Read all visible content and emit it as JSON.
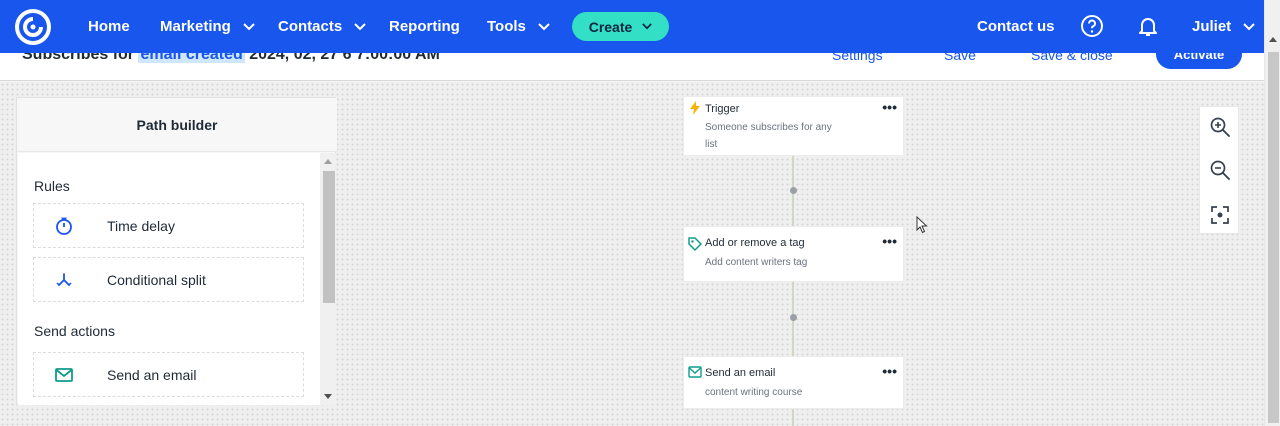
{
  "nav": {
    "home": "Home",
    "marketing": "Marketing",
    "contacts": "Contacts",
    "reporting": "Reporting",
    "tools": "Tools",
    "create": "Create",
    "contact_us": "Contact us",
    "user": "Juliet"
  },
  "subheader": {
    "title_prefix": "Subscribes for ",
    "title_highlight": "email created",
    "title_suffix": " 2024, 02, 27 6 7:00:00 AM",
    "settings": "Settings",
    "save": "Save",
    "save_close": "Save & close",
    "activate": "Activate"
  },
  "builder": {
    "title": "Path builder",
    "rules_label": "Rules",
    "rules": [
      {
        "label": "Time delay",
        "icon": "stopwatch-icon"
      },
      {
        "label": "Conditional split",
        "icon": "split-icon"
      }
    ],
    "send_label": "Send actions",
    "send": [
      {
        "label": "Send an email",
        "icon": "envelope-icon"
      }
    ]
  },
  "flow": {
    "trigger": {
      "title": "Trigger",
      "desc": "Someone subscribes for any list",
      "icon": "lightning-icon"
    },
    "tag": {
      "title": "Add or remove a tag",
      "desc": "Add content writers tag",
      "icon": "tag-icon"
    },
    "email": {
      "title": "Send an email",
      "desc": "content writing course",
      "icon": "envelope-icon"
    },
    "menu": "•••"
  },
  "colors": {
    "nav_bg": "#1856ed",
    "create_bg": "#34e0c5",
    "accent_teal": "#0f9d8a",
    "accent_blue": "#1856ed",
    "trigger_yellow": "#f5b400"
  }
}
